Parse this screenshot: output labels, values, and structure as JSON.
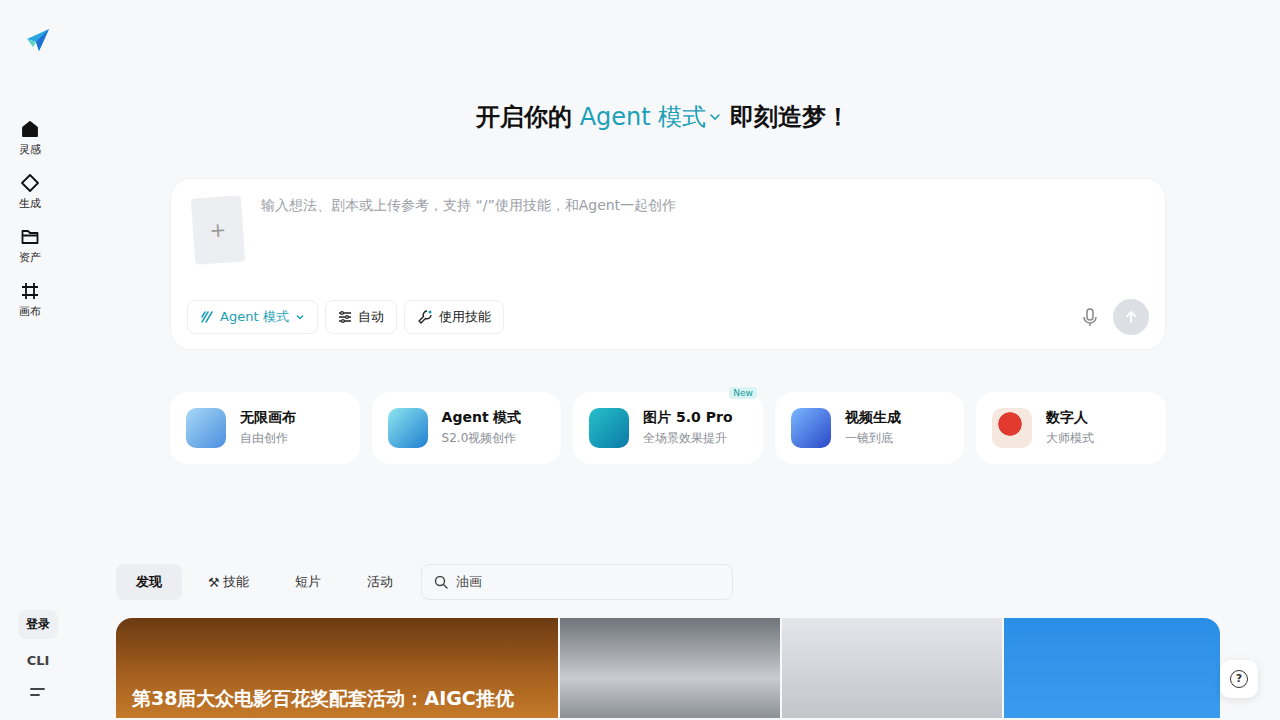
{
  "sidebar": {
    "items": [
      {
        "label": "灵感",
        "kind": "home",
        "selected": true
      },
      {
        "label": "生成",
        "kind": "generate",
        "selected": false
      },
      {
        "label": "资产",
        "kind": "assets",
        "selected": false
      },
      {
        "label": "画布",
        "kind": "canvas",
        "selected": false
      }
    ],
    "login": "登录",
    "cli": "CLI"
  },
  "heading": {
    "prefix": "开启你的",
    "mode": "Agent 模式",
    "suffix": "即刻造梦！"
  },
  "composer": {
    "upload": "+",
    "placeholder": "输入想法、剧本或上传参考，支持 “/”使用技能，和Agent一起创作",
    "chips": [
      {
        "label": "Agent 模式",
        "kind": "mode"
      },
      {
        "label": "自动",
        "kind": "settings"
      },
      {
        "label": "使用技能",
        "kind": "skill"
      }
    ],
    "send_disabled": true
  },
  "features": [
    {
      "title": "无限画布",
      "subtitle": "自由创作",
      "kind": "canvas",
      "badge": ""
    },
    {
      "title": "Agent 模式",
      "subtitle": "S2.0视频创作",
      "kind": "agent",
      "badge": ""
    },
    {
      "title": "图片 5.0 Pro",
      "subtitle": "全场景效果提升",
      "kind": "image",
      "badge": "New"
    },
    {
      "title": "视频生成",
      "subtitle": "一镜到底",
      "kind": "video",
      "badge": ""
    },
    {
      "title": "数字人",
      "subtitle": "大师模式",
      "kind": "avatar",
      "badge": ""
    }
  ],
  "tabs": [
    {
      "label": "发现",
      "selected": true,
      "icon": ""
    },
    {
      "label": "技能",
      "selected": false,
      "icon": "⚒"
    },
    {
      "label": "短片",
      "selected": false,
      "icon": ""
    },
    {
      "label": "活动",
      "selected": false,
      "icon": ""
    }
  ],
  "search": {
    "placeholder": "油画"
  },
  "gallery": [
    {
      "caption": "第38届大众电影百花奖配套活动：AIGC推优",
      "kind": "award"
    },
    {
      "caption": "",
      "kind": "ornament"
    },
    {
      "caption": "",
      "kind": "robot"
    },
    {
      "caption": "",
      "kind": "sky"
    }
  ],
  "help": "?"
}
